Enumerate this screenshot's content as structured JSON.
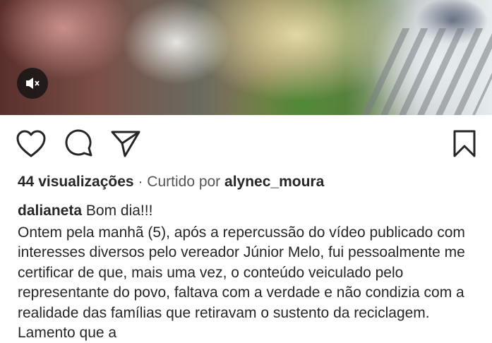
{
  "video": {
    "mute_icon": "speaker-muted-icon"
  },
  "actions": {
    "like_icon": "heart-icon",
    "comment_icon": "comment-bubble-icon",
    "share_icon": "paper-plane-icon",
    "save_icon": "bookmark-icon"
  },
  "meta": {
    "views": "44 visualizações",
    "separator": "·",
    "liked_by_prefix": "Curtido por",
    "liked_by_user": "alynec_moura"
  },
  "caption": {
    "username": "dalianeta",
    "first_line": "Bom dia!!!",
    "body": "Ontem pela manhã (5), após a repercussão do vídeo publicado com interesses diversos pelo vereador Júnior Melo, fui pessoalmente me certificar de que, mais uma vez, o conteúdo veiculado pelo representante do povo, faltava com a verdade e não condizia com a realidade das famílias que retiravam o sustento da reciclagem. Lamento que a"
  }
}
